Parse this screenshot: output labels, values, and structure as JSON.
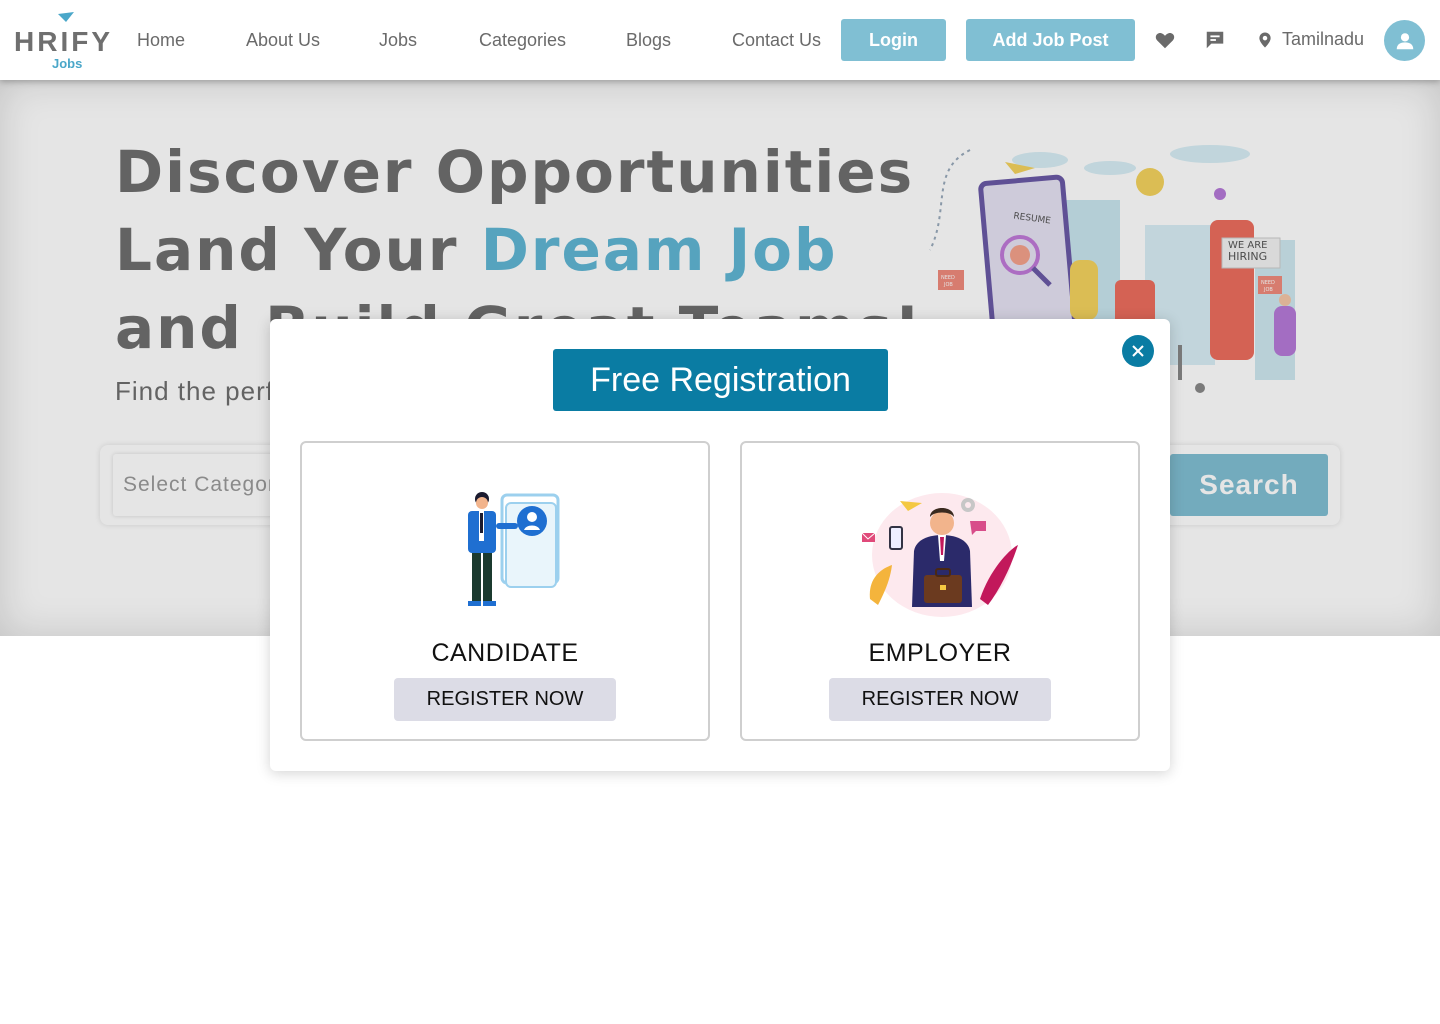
{
  "brand": {
    "name": "HRIFY",
    "sub": "Jobs"
  },
  "nav": {
    "items": [
      {
        "label": "Home",
        "key": "home"
      },
      {
        "label": "About Us",
        "key": "about"
      },
      {
        "label": "Jobs",
        "key": "jobs"
      },
      {
        "label": "Categories",
        "key": "categories"
      },
      {
        "label": "Blogs",
        "key": "blogs"
      },
      {
        "label": "Contact Us",
        "key": "contact"
      }
    ],
    "login_label": "Login",
    "add_job_label": "Add Job Post",
    "favorites_icon": "heart-icon",
    "messages_icon": "chat-icon",
    "location_icon": "map-pin-icon",
    "location": "Tamilnadu",
    "profile_icon": "user-icon"
  },
  "hero": {
    "line1": "Discover Opportunities",
    "line2_plain": "Land Your ",
    "line2_accent": "Dream Job",
    "line3": "and Build Great Teams!",
    "subtitle": "Find the perfect",
    "search": {
      "category_placeholder": "Select Category",
      "search_label": "Search"
    },
    "illustration": {
      "resume_text": "RESUME",
      "hiring_text_1": "WE ARE",
      "hiring_text_2": "HIRING",
      "sign_text_1": "NEED",
      "sign_text_2": "JOB"
    }
  },
  "modal": {
    "title": "Free Registration",
    "close_icon": "close-icon",
    "candidate": {
      "label": "CANDIDATE",
      "button": "REGISTER NOW"
    },
    "employer": {
      "label": "EMPLOYER",
      "button": "REGISTER NOW"
    }
  },
  "colors": {
    "accent": "#80bfd3",
    "accent_text": "#60b6d4",
    "modal_primary": "#0a7ca3",
    "register_button": "#dcdce6"
  }
}
